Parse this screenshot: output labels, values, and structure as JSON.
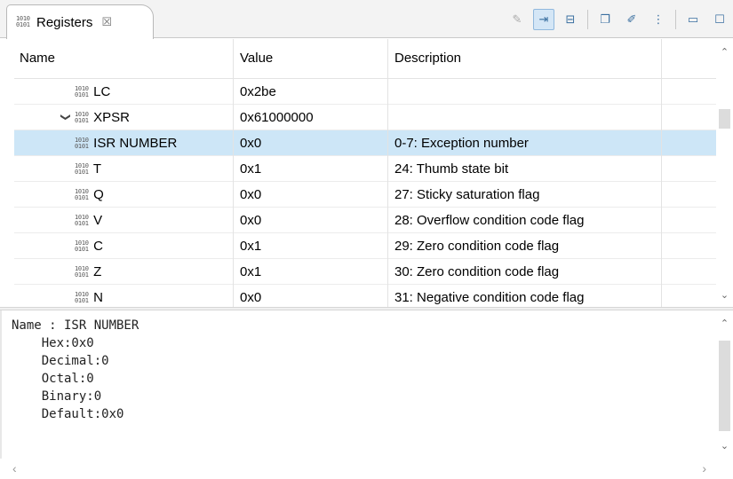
{
  "tab": {
    "title": "Registers",
    "close_glyph": "☒"
  },
  "toolbar": {
    "buttons": [
      {
        "icon": "clear-icon",
        "glyph": "✎"
      },
      {
        "icon": "link-with-debug-icon",
        "glyph": "⇥"
      },
      {
        "icon": "collapse-all-icon",
        "glyph": "⊟"
      },
      {
        "icon": "new-group-icon",
        "glyph": "❐"
      },
      {
        "icon": "edit-group-icon",
        "glyph": "✐"
      },
      {
        "icon": "view-menu-icon",
        "glyph": "⋮"
      },
      {
        "icon": "minimize-icon",
        "glyph": "▭"
      },
      {
        "icon": "maximize-icon",
        "glyph": "☐"
      }
    ]
  },
  "columns": {
    "name": "Name",
    "value": "Value",
    "description": "Description"
  },
  "rows": [
    {
      "name": "LC",
      "value": "0x2be",
      "description": "",
      "indent": 1
    },
    {
      "name": "XPSR",
      "value": "0x61000000",
      "description": "",
      "indent": 0,
      "expanded": true
    },
    {
      "name": "ISR NUMBER",
      "value": "0x0",
      "description": "0-7: Exception number",
      "indent": 1,
      "selected": true
    },
    {
      "name": "T",
      "value": "0x1",
      "description": "24: Thumb state bit",
      "indent": 1
    },
    {
      "name": "Q",
      "value": "0x0",
      "description": "27: Sticky saturation flag",
      "indent": 1
    },
    {
      "name": "V",
      "value": "0x0",
      "description": "28: Overflow condition code flag",
      "indent": 1
    },
    {
      "name": "C",
      "value": "0x1",
      "description": "29: Zero condition code flag",
      "indent": 1
    },
    {
      "name": "Z",
      "value": "0x1",
      "description": "30: Zero condition code flag",
      "indent": 1
    },
    {
      "name": "N",
      "value": "0x0",
      "description": "31: Negative condition code flag",
      "indent": 1
    }
  ],
  "detail": {
    "lines": [
      "Name : ISR NUMBER",
      "    Hex:0x0",
      "    Decimal:0",
      "    Octal:0",
      "    Binary:0",
      "    Default:0x0"
    ]
  },
  "colors": {
    "selection": "#cde6f7",
    "toolbar_active": "#d4e6f6"
  }
}
